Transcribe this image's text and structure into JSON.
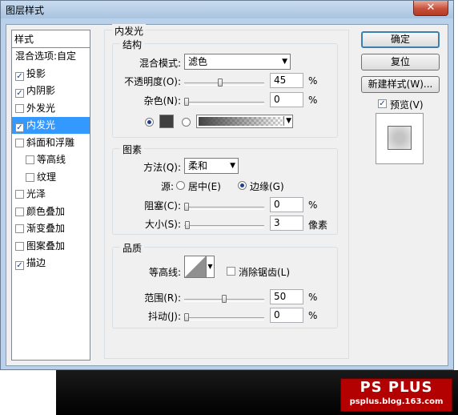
{
  "window": {
    "title": "图层样式",
    "close_glyph": "✕"
  },
  "style_list": {
    "header": "样式",
    "items": [
      {
        "label": "混合选项:自定",
        "checkbox": false,
        "checked": false,
        "indent": false,
        "selected": false
      },
      {
        "label": "投影",
        "checkbox": true,
        "checked": true,
        "indent": false,
        "selected": false
      },
      {
        "label": "内阴影",
        "checkbox": true,
        "checked": true,
        "indent": false,
        "selected": false
      },
      {
        "label": "外发光",
        "checkbox": true,
        "checked": false,
        "indent": false,
        "selected": false
      },
      {
        "label": "内发光",
        "checkbox": true,
        "checked": true,
        "indent": false,
        "selected": true
      },
      {
        "label": "斜面和浮雕",
        "checkbox": true,
        "checked": false,
        "indent": false,
        "selected": false
      },
      {
        "label": "等高线",
        "checkbox": true,
        "checked": false,
        "indent": true,
        "selected": false
      },
      {
        "label": "纹理",
        "checkbox": true,
        "checked": false,
        "indent": true,
        "selected": false
      },
      {
        "label": "光泽",
        "checkbox": true,
        "checked": false,
        "indent": false,
        "selected": false
      },
      {
        "label": "颜色叠加",
        "checkbox": true,
        "checked": false,
        "indent": false,
        "selected": false
      },
      {
        "label": "渐变叠加",
        "checkbox": true,
        "checked": false,
        "indent": false,
        "selected": false
      },
      {
        "label": "图案叠加",
        "checkbox": true,
        "checked": false,
        "indent": false,
        "selected": false
      },
      {
        "label": "描边",
        "checkbox": true,
        "checked": true,
        "indent": false,
        "selected": false
      }
    ]
  },
  "panel": {
    "title": "内发光",
    "structure": {
      "title": "结构",
      "blend_mode_label": "混合模式:",
      "blend_mode_value": "滤色",
      "opacity_label": "不透明度(O):",
      "opacity_value": "45",
      "opacity_level": 0.45,
      "percent": "%",
      "noise_label": "杂色(N):",
      "noise_value": "0",
      "noise_level": 0,
      "swatch_color": "#404040"
    },
    "elements": {
      "title": "图素",
      "method_label": "方法(Q):",
      "method_value": "柔和",
      "source_label": "源:",
      "source_center": "居中(E)",
      "source_edge": "边缘(G)",
      "choke_label": "阻塞(C):",
      "choke_value": "0",
      "choke_level": 0,
      "size_label": "大小(S):",
      "size_value": "3",
      "size_level": 0.012,
      "size_unit": "像素"
    },
    "quality": {
      "title": "品质",
      "contour_label": "等高线:",
      "antialias_label": "消除锯齿(L)",
      "range_label": "范围(R):",
      "range_value": "50",
      "range_level": 0.5,
      "jitter_label": "抖动(J):",
      "jitter_value": "0",
      "jitter_level": 0
    }
  },
  "buttons": {
    "ok": "确定",
    "reset": "复位",
    "new_style": "新建样式(W)...",
    "preview": "预览(V)"
  },
  "watermark": {
    "line1": "PS PLUS",
    "line2": "psplus.blog.163.com"
  }
}
